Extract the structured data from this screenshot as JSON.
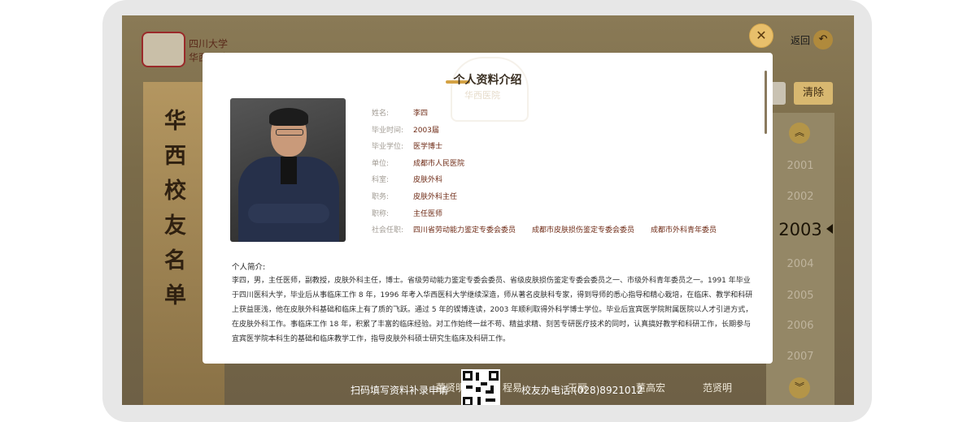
{
  "background": {
    "school_name_small": "四川大学",
    "school_name": "华西医院",
    "panel_title_chars": [
      "华",
      "西",
      "校",
      "友",
      "名",
      "单"
    ],
    "clear_button": "清除",
    "back_label": "返回",
    "years": [
      "2001",
      "2002",
      "2003",
      "2004",
      "2005",
      "2006",
      "2007"
    ],
    "active_year": "2003",
    "bottom_names": [
      "董贤明",
      "程易",
      "王丽",
      "董高宏",
      "范贤明"
    ],
    "scan_text": "扫码填写资料补录申请",
    "phone_text": "校友办电话:(028)8921012"
  },
  "modal": {
    "title": "个人资料介绍",
    "watermark": "华西医院",
    "fields": [
      {
        "label": "姓名:",
        "value": "李四"
      },
      {
        "label": "毕业时间:",
        "value": "2003届"
      },
      {
        "label": "毕业学位:",
        "value": "医学博士"
      },
      {
        "label": "单位:",
        "value": "成都市人民医院"
      },
      {
        "label": "科室:",
        "value": "皮肤外科"
      },
      {
        "label": "职务:",
        "value": "皮肤外科主任"
      },
      {
        "label": "职称:",
        "value": "主任医师"
      }
    ],
    "social_label": "社会任职:",
    "social_items": [
      "四川省劳动能力鉴定专委会委员",
      "成都市皮肤损伤鉴定专委会委员",
      "成都市外科青年委员"
    ],
    "bio_label": "个人简介:",
    "bio": "李四，男，主任医师，副教授，皮肤外科主任，博士。省级劳动能力鉴定专委会委员、省级皮肤损伤鉴定专委会委员之一、市级外科青年委员之一。1991 年毕业于四川医科大学，毕业后从事临床工作 8 年，1996 年考入华西医科大学继续深造，师从著名皮肤科专家，得到导师的悉心指导和精心栽培，在临床、教学和科研上获益匪浅，他在皮肤外科基础和临床上有了质的飞跃。通过 5 年的锲博连读，2003 年顺利取得外科学博士学位。毕业后宜宾医学院附属医院以人才引进方式，在皮肤外科工作。事临床工作 18 年，积累了丰富的临床经验。对工作始终一丝不苟、精益求精、刻苦专研医疗技术的同时，认真搞好教学和科研工作，长期参与宜宾医学院本科生的基础和临床教学工作，指导皮肤外科硕士研究生临床及科研工作。"
  },
  "icons": {
    "close": "close-icon",
    "back": "back-arrow-icon",
    "up": "chevron-up-icon",
    "down": "chevron-down-icon"
  },
  "colors": {
    "accent": "#d4a244",
    "value_text": "#6e2a15",
    "close_button": "#e8bf6b"
  }
}
